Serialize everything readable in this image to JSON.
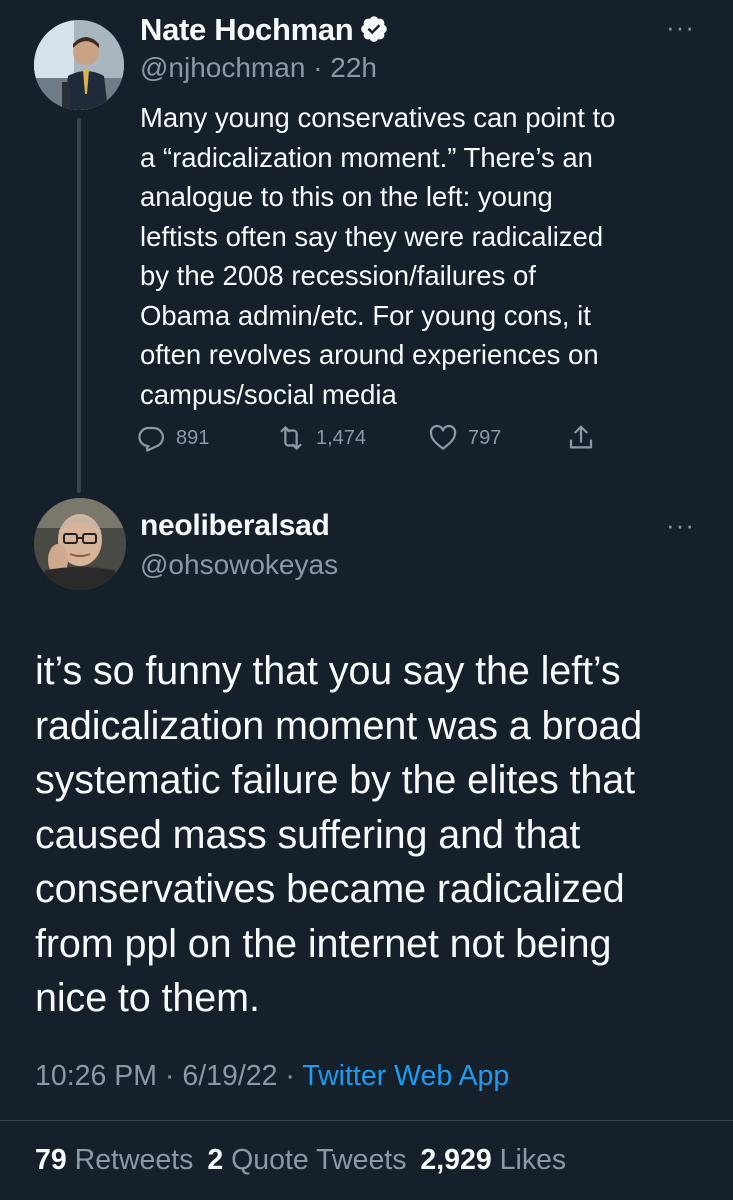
{
  "parent_tweet": {
    "author_name": "Nate Hochman",
    "handle": "@njhochman",
    "time": "· 22h",
    "text": "Many young conservatives can point to\na “radicalization moment.” There’s an\nanalogue to this on the left: young\nleftists often say they were radicalized\nby the 2008 recession/failures of\nObama admin/etc. For young cons, it\noften revolves around experiences on\ncampus/social media",
    "replies": "891",
    "retweets": "1,474",
    "likes": "797",
    "verified": true,
    "icons": [
      "verified-badge-icon",
      "reply-icon",
      "retweet-icon",
      "like-icon",
      "share-icon",
      "more-icon"
    ]
  },
  "reply_tweet": {
    "author_name": "neoliberalsad",
    "handle": "@ohsowokeyas",
    "text": "it’s so funny that you say the left’s\nradicalization moment was a broad\nsystematic failure by the elites that\ncaused mass suffering and that\nconservatives became radicalized\nfrom ppl on the internet not being\nnice to them.",
    "time": "10:26 PM",
    "date": "6/19/22",
    "source": "Twitter Web App",
    "separator": "·",
    "retweets_count": "79",
    "retweets_label": "Retweets",
    "quote_count": "2",
    "quote_label": "Quote Tweets",
    "likes_count": "2,929",
    "likes_label": "Likes"
  },
  "colors": {
    "background": "#15202b",
    "text_primary": "#f7f9f9",
    "text_secondary": "#8b98a5",
    "accent": "#1d9bf0",
    "divider": "#38444d"
  }
}
